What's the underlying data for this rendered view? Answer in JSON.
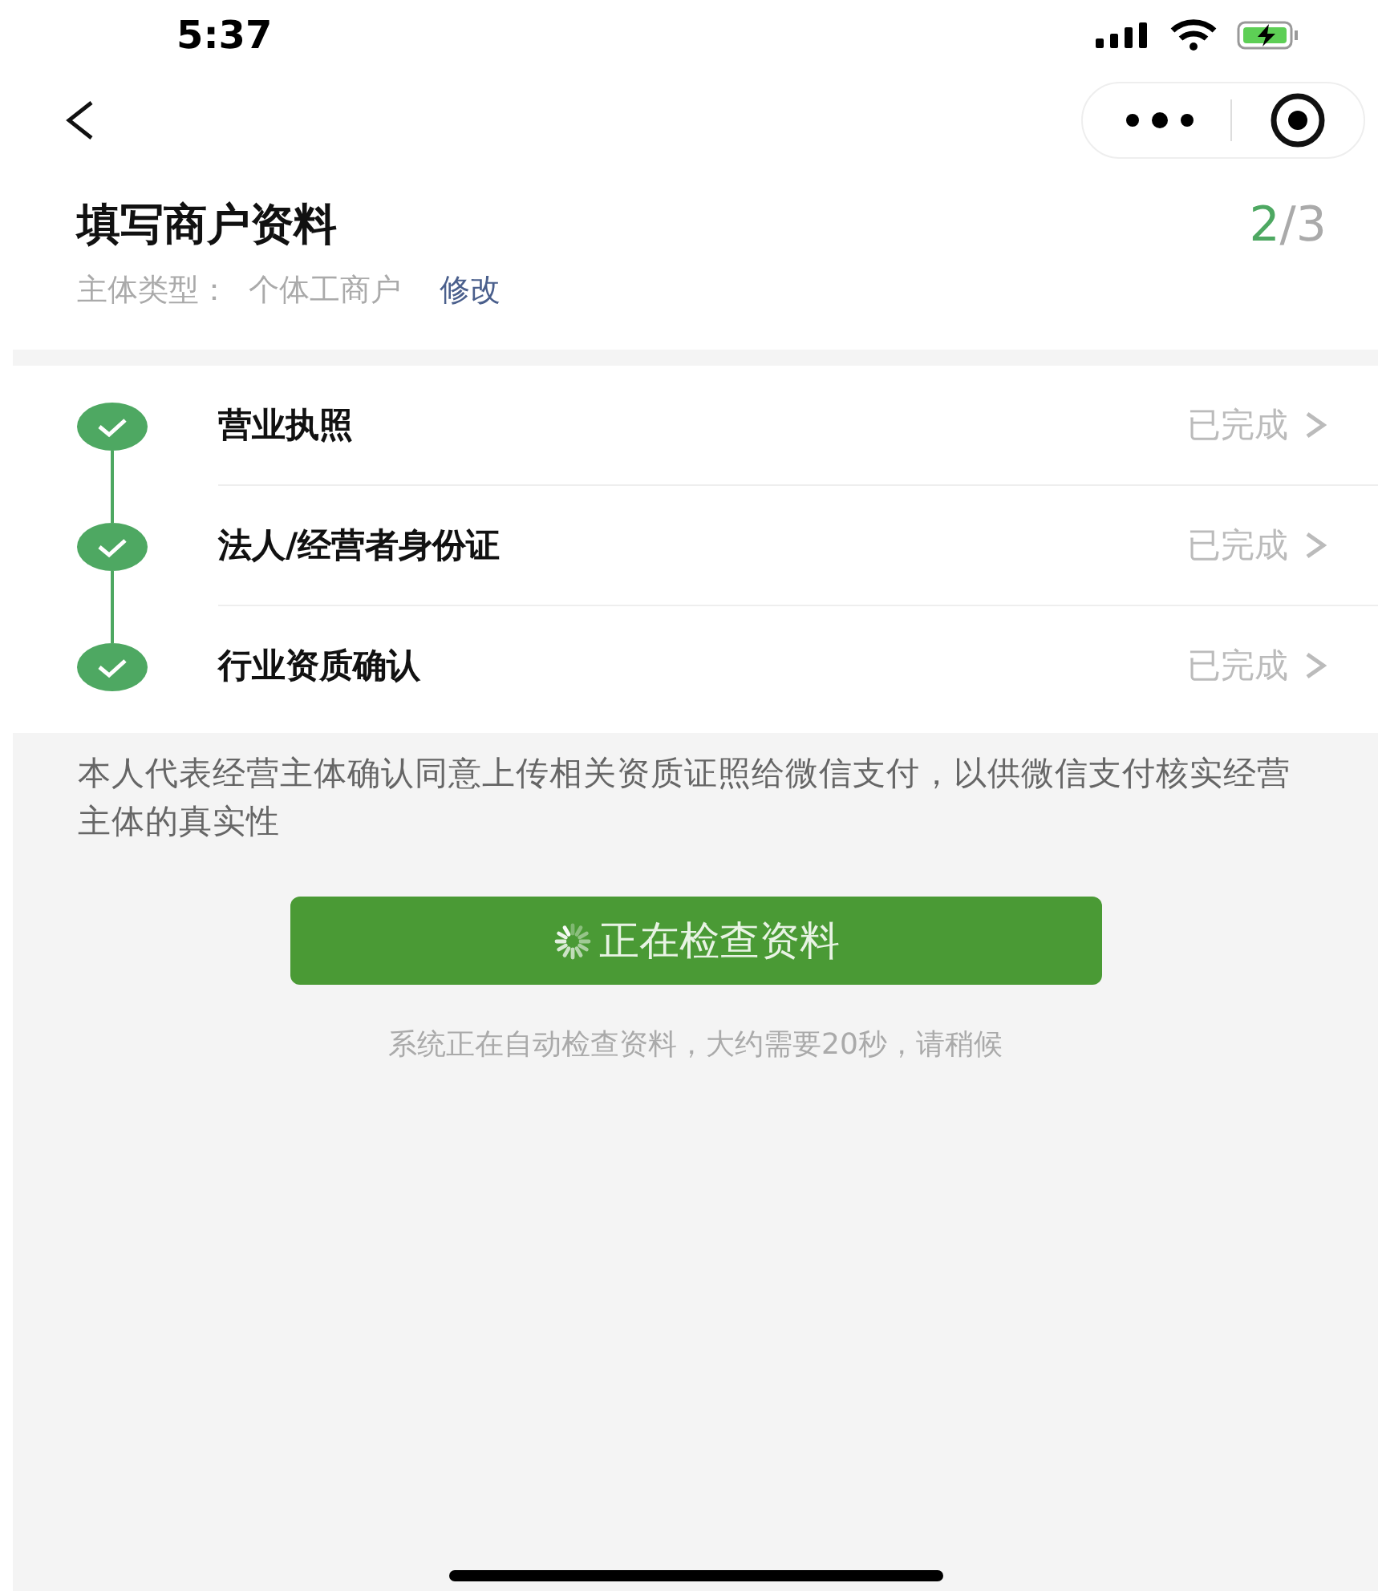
{
  "status_bar": {
    "time": "5:37"
  },
  "header": {
    "title": "填写商户资料",
    "progress_current": "2",
    "progress_total": "/3",
    "subject_label": "主体类型：",
    "subject_value": "个体工商户",
    "edit_link": "修改"
  },
  "steps": [
    {
      "label": "营业执照",
      "status": "已完成",
      "completed": true
    },
    {
      "label": "法人/经营者身份证",
      "status": "已完成",
      "completed": true
    },
    {
      "label": "行业资质确认",
      "status": "已完成",
      "completed": true
    }
  ],
  "consent_text": "本人代表经营主体确认同意上传相关资质证照给微信支付，以供微信支付核实经营主体的真实性",
  "submit_button": {
    "label": "正在检查资料",
    "loading": true
  },
  "hint": "系统正在自动检查资料，大约需要20秒，请稍候"
}
